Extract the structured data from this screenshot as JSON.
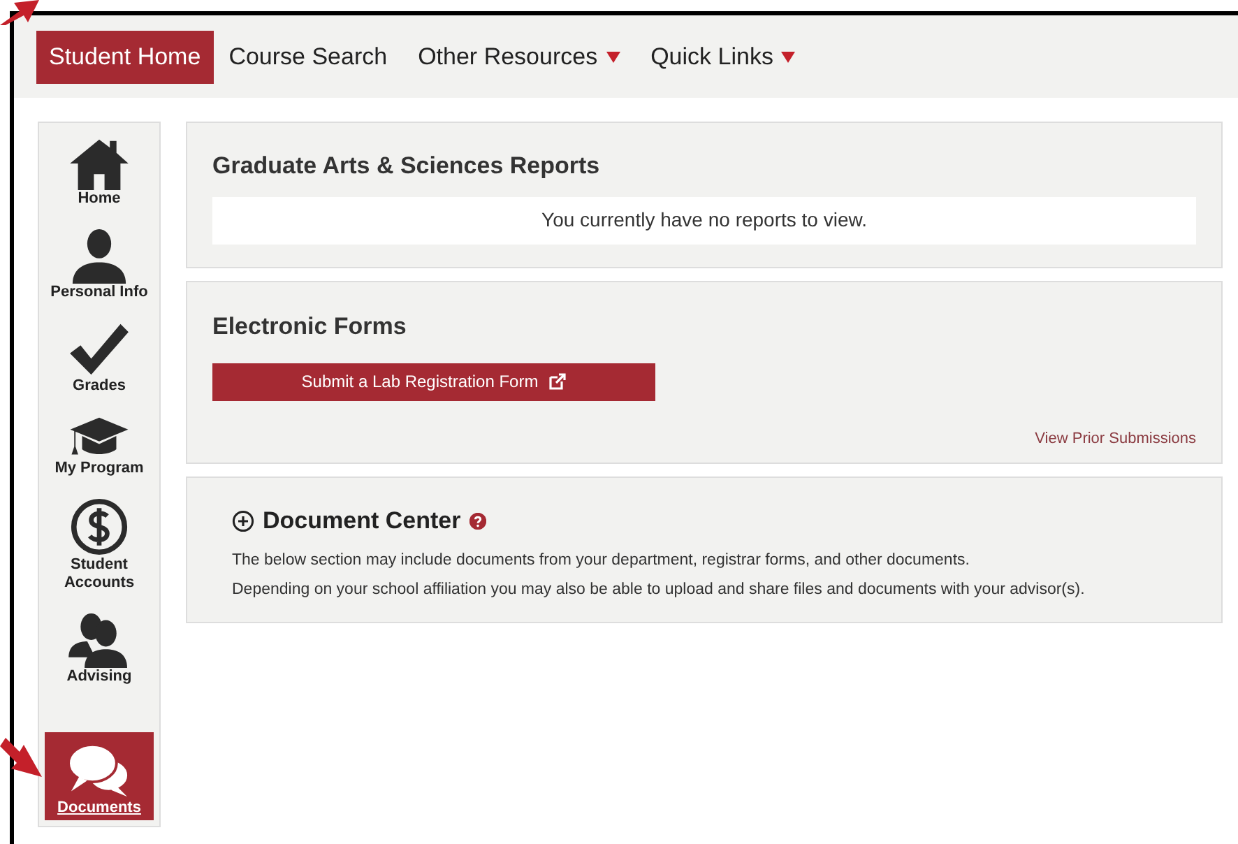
{
  "top_nav": [
    {
      "label": "Student Home",
      "selected": true,
      "dropdown": false
    },
    {
      "label": "Course Search",
      "selected": false,
      "dropdown": false
    },
    {
      "label": "Other Resources",
      "selected": false,
      "dropdown": true
    },
    {
      "label": "Quick Links",
      "selected": false,
      "dropdown": true
    }
  ],
  "sidebar": {
    "items": [
      {
        "label": "Home",
        "selected": false
      },
      {
        "label": "Personal Info",
        "selected": false
      },
      {
        "label": "Grades",
        "selected": false
      },
      {
        "label": "My Program",
        "selected": false
      },
      {
        "label": "Student Accounts",
        "selected": false
      },
      {
        "label": "Advising",
        "selected": false
      },
      {
        "label": "Documents",
        "selected": true
      }
    ]
  },
  "reports": {
    "title": "Graduate Arts & Sciences Reports",
    "message": "You currently have no reports to view."
  },
  "electronic_forms": {
    "title": "Electronic Forms",
    "button": "Submit a Lab Registration Form",
    "link": "View Prior Submissions"
  },
  "document_center": {
    "title": "Document Center",
    "expanded": false,
    "paragraphs": [
      "The below section may include documents from your department, registrar forms, and other documents.",
      "Depending on your school affiliation you may also be able to upload and share files and documents with your advisor(s)."
    ]
  }
}
